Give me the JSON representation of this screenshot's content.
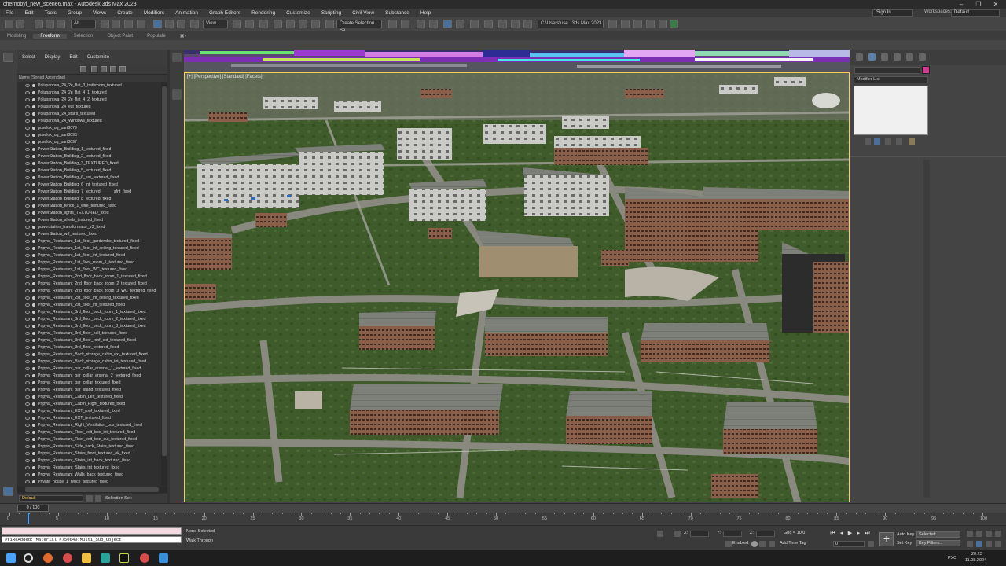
{
  "window": {
    "title": "chernobyl_new_scene6.max - Autodesk 3ds Max 2023"
  },
  "menu": [
    "File",
    "Edit",
    "Tools",
    "Group",
    "Views",
    "Create",
    "Modifiers",
    "Animation",
    "Graph Editors",
    "Rendering",
    "Customize",
    "Scripting",
    "Civil View",
    "Substance",
    "Help"
  ],
  "account": {
    "signin": "Sign In",
    "workspaces_label": "Workspaces:",
    "workspace_value": "Default"
  },
  "toolbar": {
    "filter_value": "All",
    "view_value": "View",
    "selection_set_placeholder": "Create Selection Se",
    "path_value": "C:\\Users\\use...3ds Max 2023"
  },
  "ribbon": {
    "tabs": [
      "Modeling",
      "Freeform",
      "Selection",
      "Object Paint",
      "Populate"
    ],
    "active": "Freeform"
  },
  "explorer": {
    "menu": [
      "Select",
      "Display",
      "Edit",
      "Customize"
    ],
    "column_header": "Name (Sorted Ascending)",
    "items": [
      "Polupanova_24_2e_flat_3_bathroom_textured",
      "Polupanova_24_2e_flat_4_1_textured",
      "Polupanova_24_2e_flat_4_2_textured",
      "Polupanova_24_ext_textured",
      "Polupanova_24_stairs_textured",
      "Polupanova_24_Windows_textured",
      "poselok_ug_part3079",
      "poselok_ug_part3093",
      "poselok_ug_part3097",
      "PowerStation_Building_1_textured_fixed",
      "PowerStation_Building_2_textured_fixed",
      "PowerStation_Building_3_TEXTURED_fixed",
      "PowerStation_Building_5_textured_fixed",
      "PowerStation_Building_6_ext_textured_fixed",
      "PowerStation_Building_6_int_textured_fixed",
      "PowerStation_Building_7_textured______sfnt_fixed",
      "PowerStation_Building_8_textured_fixed",
      "PowerStation_fence_1_wire_textured_fixed",
      "PowerStation_lights_TEXTURED_fixed",
      "PowerStation_sheds_textured_fixed",
      "powerstation_transformator_v3_fixed",
      "PowerStation_wtf_textured_fixed",
      "Pripyat_Restaurant_1st_floor_garderobe_textured_fixed",
      "Pripyat_Restaurant_1st_floor_int_ceiling_textured_fixed",
      "Pripyat_Restaurant_1st_floor_int_textured_fixed",
      "Pripyat_Restaurant_1st_floor_room_1_textured_fixed",
      "Pripyat_Restaurant_1st_floor_WC_textured_fixed",
      "Pripyat_Restaurant_2nd_floor_back_room_1_textured_fixed",
      "Pripyat_Restaurant_2nd_floor_back_room_2_textured_fixed",
      "Pripyat_Restaurant_2nd_floor_back_room_3_WC_textured_fixed",
      "Pripyat_Restaurant_2st_floor_int_ceiling_textured_fixed",
      "Pripyat_Restaurant_2st_floor_int_textured_fixed",
      "Pripyat_Restaurant_3rd_floor_back_room_1_textured_fixed",
      "Pripyat_Restaurant_3rd_floor_back_room_2_textured_fixed",
      "Pripyat_Restaurant_3rd_floor_back_room_3_textured_fixed",
      "Pripyat_Restaurant_3rd_floor_hall_textured_fixed",
      "Pripyat_Restaurant_3rd_floor_roof_ext_textured_fixed",
      "Pripyat_Restaurant_3rd_floor_textured_fixed",
      "Pripyat_Restaurant_Back_storage_cabin_ext_textured_fixed",
      "Pripyat_Restaurant_Back_storage_cabin_int_textured_fixed",
      "Pripyat_Restaurant_bar_cellar_arsenal_1_textured_fixed",
      "Pripyat_Restaurant_bar_cellar_arsenal_2_textured_fixed",
      "Pripyat_Restaurant_bar_cellar_textured_fixed",
      "Pripyat_Restaurant_bar_stand_textured_fixed",
      "Pripyat_Restaurant_Cabin_Left_textured_fixed",
      "Pripyat_Restaurant_Cabin_Right_textured_fixed",
      "Pripyat_Restaurant_EXT_roof_textured_fixed",
      "Pripyat_Restaurant_EXT_textured_fixed",
      "Pripyat_Restaurant_Right_Ventilation_box_textured_fixed",
      "Pripyat_Restaurant_Roof_exit_box_int_textured_fixed",
      "Pripyat_Restaurant_Roof_exit_box_out_textured_fixed",
      "Pripyat_Restaurant_Side_back_Stairs_textured_fixed",
      "Pripyat_Restaurant_Stairs_front_textured_ok_fixed",
      "Pripyat_Restaurant_Stairs_int_back_textured_fixed",
      "Pripyat_Restaurant_Stairs_int_textured_fixed",
      "Pripyat_Restaurant_Walls_back_textured_fixed",
      "Private_house_1_fence_textured_fixed"
    ],
    "layer": "Default",
    "selection_set_label": "Selection Set:"
  },
  "viewport": {
    "label": "[+] [Perspective] [Standard] [Facets]"
  },
  "command_panel": {
    "modifier_list": "Modifier List",
    "object_color": "#d03a8f"
  },
  "timeline": {
    "slider_label": "0 / 100",
    "ticks": [
      "0",
      "5",
      "10",
      "15",
      "20",
      "25",
      "30",
      "35",
      "40",
      "45",
      "50",
      "55",
      "60",
      "65",
      "70",
      "75",
      "80",
      "85",
      "90",
      "95",
      "100"
    ]
  },
  "status": {
    "maxscript_output": "#t1ReAdded: Material #750640:Multi_Sub_Object",
    "selection": "None Selected",
    "prompt": "Walk Through",
    "x_label": "X:",
    "y_label": "Y:",
    "z_label": "Z:",
    "grid": "Grid = 10,0",
    "enabled": "Enabled:",
    "add_time_tag": "Add Time Tag",
    "auto_key": "Auto Key",
    "auto_key_value": "Selected",
    "set_key": "Set Key",
    "key_filters": "Key Filters...",
    "frame_value": "0"
  },
  "taskbar": {
    "lang": "РУС",
    "time": "20:23",
    "date": "11.08.2024"
  }
}
